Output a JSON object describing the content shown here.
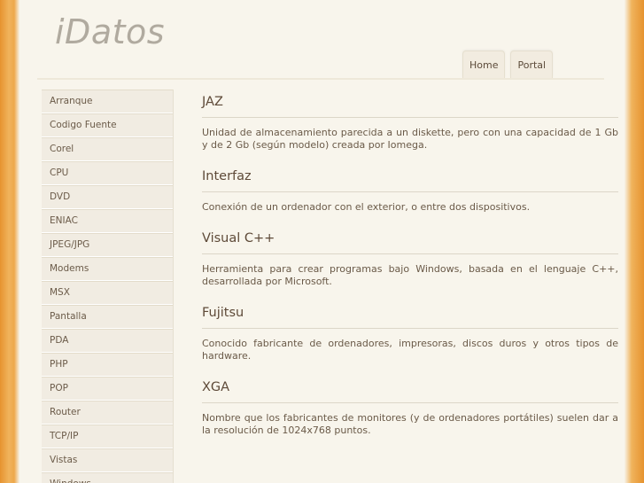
{
  "site": {
    "logo": "iDatos"
  },
  "nav": {
    "tabs": [
      "Home",
      "Portal"
    ]
  },
  "sidebar": {
    "items": [
      "Arranque",
      "Codigo Fuente",
      "Corel",
      "CPU",
      "DVD",
      "ENIAC",
      "JPEG/JPG",
      "Modems",
      "MSX",
      "Pantalla",
      "PDA",
      "PHP",
      "POP",
      "Router",
      "TCP/IP",
      "Vistas",
      "Windows"
    ]
  },
  "entries": [
    {
      "title": "JAZ",
      "text": "Unidad de almacenamiento parecida a un diskette, pero con una capacidad de 1 Gb y de 2 Gb (según modelo) creada por Iomega."
    },
    {
      "title": "Interfaz",
      "text": "Conexión de un ordenador con el exterior, o entre dos dispositivos."
    },
    {
      "title": "Visual C++",
      "text": "Herramienta para crear programas bajo Windows, basada en el lenguaje C++, desarrollada por Microsoft."
    },
    {
      "title": "Fujitsu",
      "text": "Conocido fabricante de ordenadores, impresoras, discos duros y otros tipos de hardware."
    },
    {
      "title": "XGA",
      "text": "Nombre que los fabricantes de monitores (y de ordenadores portátiles) suelen dar a la resolución de 1024x768 puntos."
    }
  ]
}
